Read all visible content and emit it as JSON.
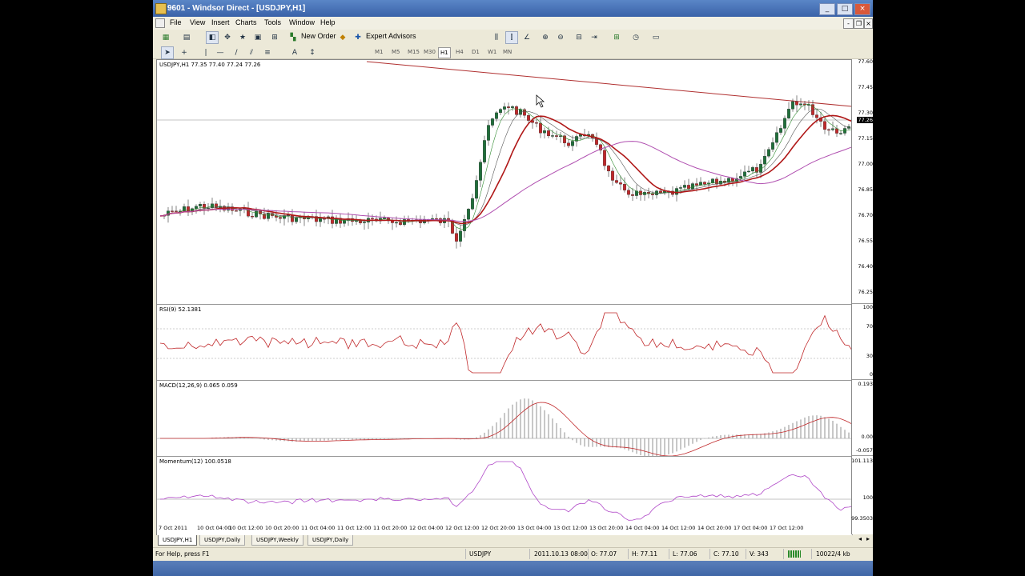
{
  "window": {
    "title": "9601 - Windsor Direct - [USDJPY,H1]",
    "min": "_",
    "max": "□",
    "close": "×"
  },
  "menu": [
    "File",
    "View",
    "Insert",
    "Charts",
    "Tools",
    "Window",
    "Help"
  ],
  "mdi": {
    "min": "-",
    "restore": "❐",
    "close": "×"
  },
  "toolbar1": {
    "new_order": "New Order",
    "expert_advisors": "Expert Advisors"
  },
  "timeframes": [
    "M1",
    "M5",
    "M15",
    "M30",
    "H1",
    "H4",
    "D1",
    "W1",
    "MN"
  ],
  "active_timeframe": "H1",
  "main_panel": {
    "label": "USDJPY,H1  77.35 77.40 77.24 77.26",
    "price_ticks": [
      "77.60",
      "77.45",
      "77.30",
      "77.15",
      "77.00",
      "76.85",
      "76.70",
      "76.55",
      "76.40",
      "76.25"
    ],
    "current_price": "77.26"
  },
  "rsi_panel": {
    "label": "RSI(9) 52.1381",
    "ticks": [
      "100",
      "70",
      "30",
      "0"
    ]
  },
  "macd_panel": {
    "label": "MACD(12,26,9) 0.065 0.059",
    "ticks": [
      "0.193",
      "0.00",
      "-0.057"
    ]
  },
  "momentum_panel": {
    "label": "Momentum(12) 100.0518",
    "ticks": [
      "101.113",
      "100",
      "99.3503"
    ]
  },
  "time_labels": [
    "7 Oct 2011",
    "10 Oct 04:00",
    "10 Oct 12:00",
    "10 Oct 20:00",
    "11 Oct 04:00",
    "11 Oct 12:00",
    "11 Oct 20:00",
    "12 Oct 04:00",
    "12 Oct 12:00",
    "12 Oct 20:00",
    "13 Oct 04:00",
    "13 Oct 12:00",
    "13 Oct 20:00",
    "14 Oct 04:00",
    "14 Oct 12:00",
    "14 Oct 20:00",
    "17 Oct 04:00",
    "17 Oct 12:00"
  ],
  "tabs": [
    "USDJPY,H1",
    "USDJPY,Daily",
    "USDJPY,Weekly",
    "USDJPY,Daily"
  ],
  "status": {
    "help": "For Help, press F1",
    "symbol": "USDJPY",
    "datetime": "2011.10.13 08:00",
    "open": "O: 77.07",
    "high": "H: 77.11",
    "low": "L: 77.06",
    "close": "C: 77.10",
    "volume": "V: 343",
    "traffic": "10022/4 kb"
  },
  "colors": {
    "bull": "#1f6f3a",
    "bear": "#c0282a",
    "ma_red": "#b01818",
    "ma_purple": "#b04fb0",
    "trendline": "#b03030",
    "momentum": "#b048c8"
  }
}
